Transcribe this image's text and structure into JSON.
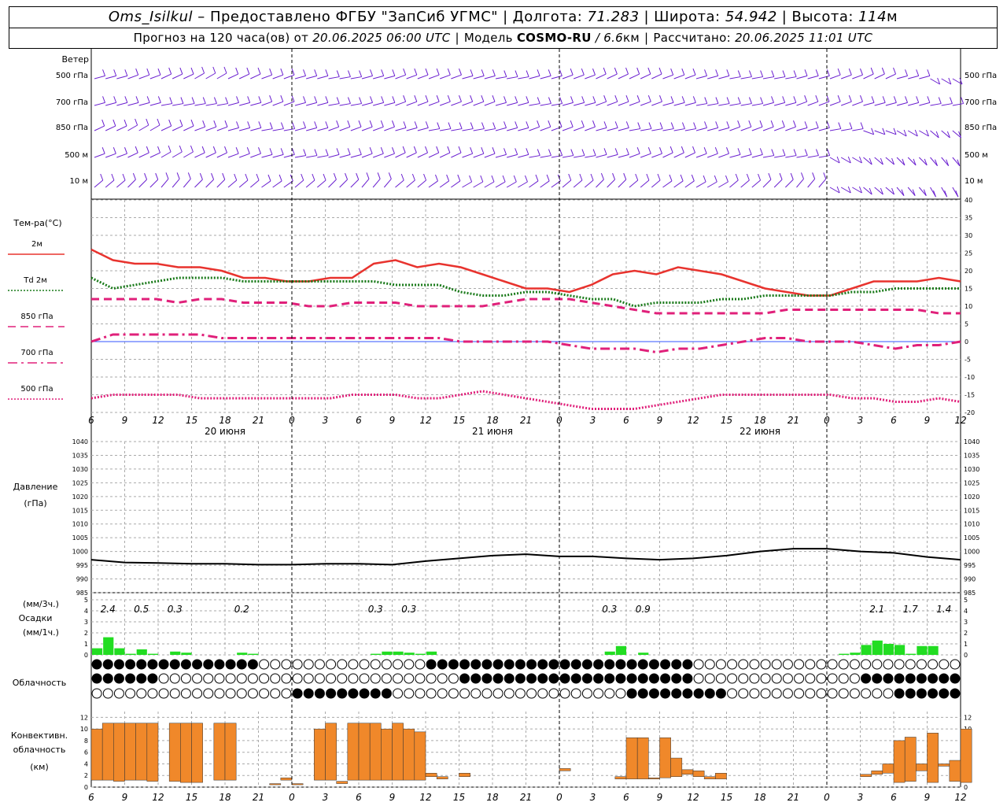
{
  "header": {
    "station": "Oms_Isilkul",
    "provided": "– Предоставлено ФГБУ \"ЗапСиб УГМС\"",
    "lon_label": "Долгота:",
    "lon": "71.283",
    "lat_label": "Широта:",
    "lat": "54.942",
    "alt_label": "Высота:",
    "alt": "114",
    "alt_unit": "м",
    "forecast_prefix": "Прогноз на 120 часа(ов) от",
    "forecast_time": "20.06.2025 06:00 UTC",
    "model_label": "Модель",
    "model_name": "COSMO-RU",
    "model_res": "/ 6.6",
    "model_res_unit": "км",
    "computed_label": "Рассчитано:",
    "computed_time": "20.06.2025 11:01 UTC"
  },
  "panels": {
    "wind": {
      "title": "Ветер",
      "levels": [
        "500 гПа",
        "700 гПа",
        "850 гПа",
        "500 м",
        "10 м"
      ]
    },
    "temperature": {
      "title": "Тем-ра(°C)",
      "legend": [
        {
          "label": "2м",
          "color": "#e8332e",
          "style": "solid"
        },
        {
          "label": "Td 2м",
          "color": "#1a7a1a",
          "style": "dotted"
        },
        {
          "label": "850 гПа",
          "color": "#e0207a",
          "style": "dashed"
        },
        {
          "label": "700 гПа",
          "color": "#e0207a",
          "style": "dashdot"
        },
        {
          "label": "500 гПа",
          "color": "#e0207a",
          "style": "dotted"
        }
      ]
    },
    "pressure": {
      "title": "Давление",
      "unit": "(гПа)"
    },
    "precip": {
      "unit3": "(мм/3ч.)",
      "title": "Осадки",
      "unit1": "(мм/1ч.)"
    },
    "cloud": {
      "title": "Облачность"
    },
    "convective": {
      "title1": "Конвективн.",
      "title2": "облачность",
      "unit": "(км)"
    }
  },
  "time_axis": {
    "hour_labels": [
      "6",
      "9",
      "12",
      "15",
      "18",
      "21",
      "0",
      "3",
      "6",
      "9",
      "12",
      "15",
      "18",
      "21",
      "0",
      "3",
      "6",
      "9",
      "12",
      "15",
      "18",
      "21",
      "0",
      "3",
      "6",
      "9",
      "12"
    ],
    "day_labels": [
      {
        "hour": 12,
        "label": "20 июня"
      },
      {
        "hour": 36,
        "label": "21 июня"
      },
      {
        "hour": 60,
        "label": "22 июня"
      }
    ]
  },
  "chart_data": [
    {
      "type": "line",
      "title": "Тем-ра(°C)",
      "ylim": [
        -20,
        40
      ],
      "yticks": [
        "40",
        "35",
        "30",
        "25",
        "20",
        "15",
        "10",
        "5",
        "0",
        "-5",
        "-10",
        "-15",
        "-20"
      ],
      "x_hours_from_start": [
        0,
        2,
        4,
        6,
        8,
        10,
        12,
        14,
        16,
        18,
        20,
        22,
        24,
        26,
        28,
        30,
        32,
        34,
        36,
        38,
        40,
        42,
        44,
        46,
        48,
        50,
        52,
        54,
        56,
        58,
        60,
        62,
        64,
        66,
        68,
        70,
        72,
        74,
        76,
        78
      ],
      "series": [
        {
          "name": "2м",
          "color": "#e8332e",
          "style": "solid",
          "values": [
            26,
            23,
            22,
            22,
            21,
            21,
            20,
            18,
            18,
            17,
            17,
            18,
            18,
            22,
            23,
            21,
            22,
            21,
            19,
            17,
            15,
            15,
            14,
            16,
            19,
            20,
            19,
            21,
            20,
            19,
            17,
            15,
            14,
            13,
            13,
            15,
            17,
            17,
            17,
            18,
            17
          ]
        },
        {
          "name": "Td 2м",
          "color": "#1a7a1a",
          "style": "dotted",
          "values": [
            18,
            15,
            16,
            17,
            18,
            18,
            18,
            17,
            17,
            17,
            17,
            17,
            17,
            17,
            16,
            16,
            16,
            14,
            13,
            13,
            14,
            14,
            13,
            12,
            12,
            10,
            11,
            11,
            11,
            12,
            12,
            13,
            13,
            13,
            13,
            14,
            14,
            15,
            15,
            15,
            15
          ]
        },
        {
          "name": "850 гПа",
          "color": "#e0207a",
          "style": "dashed",
          "values": [
            12,
            12,
            12,
            12,
            11,
            12,
            12,
            11,
            11,
            11,
            10,
            10,
            11,
            11,
            11,
            10,
            10,
            10,
            10,
            11,
            12,
            12,
            12,
            11,
            10,
            9,
            8,
            8,
            8,
            8,
            8,
            8,
            9,
            9,
            9,
            9,
            9,
            9,
            9,
            8,
            8
          ]
        },
        {
          "name": "700 гПа",
          "color": "#e0207a",
          "style": "dashdot",
          "values": [
            0,
            2,
            2,
            2,
            2,
            2,
            1,
            1,
            1,
            1,
            1,
            1,
            1,
            1,
            1,
            1,
            1,
            0,
            0,
            0,
            0,
            0,
            -1,
            -2,
            -2,
            -2,
            -3,
            -2,
            -2,
            -1,
            0,
            1,
            1,
            0,
            0,
            0,
            -1,
            -2,
            -1,
            -1,
            0
          ]
        },
        {
          "name": "500 гПа",
          "color": "#e0207a",
          "style": "dotted",
          "values": [
            -16,
            -15,
            -15,
            -15,
            -15,
            -16,
            -16,
            -16,
            -16,
            -16,
            -16,
            -16,
            -15,
            -15,
            -15,
            -16,
            -16,
            -15,
            -14,
            -15,
            -16,
            -17,
            -18,
            -19,
            -19,
            -19,
            -18,
            -17,
            -16,
            -15,
            -15,
            -15,
            -15,
            -15,
            -15,
            -16,
            -16,
            -17,
            -17,
            -16,
            -17
          ]
        }
      ]
    },
    {
      "type": "line",
      "title": "Давление",
      "ylabel": "(гПа)",
      "ylim": [
        985,
        1040
      ],
      "yticks": [
        "1040",
        "1035",
        "1030",
        "1025",
        "1020",
        "1015",
        "1010",
        "1005",
        "1000",
        "995",
        "990",
        "985"
      ],
      "series": [
        {
          "name": "",
          "color": "#000000",
          "x_hours_from_start": [
            0,
            3,
            6,
            9,
            12,
            15,
            18,
            21,
            24,
            27,
            30,
            33,
            36,
            39,
            42,
            45,
            48,
            51,
            54,
            57,
            60,
            63,
            66,
            69,
            72,
            75,
            78
          ],
          "values": [
            997,
            996,
            995.8,
            995.5,
            995.5,
            995.2,
            995.2,
            995.5,
            995.5,
            995.2,
            996.5,
            997.5,
            998.5,
            999,
            998.2,
            998.2,
            997.5,
            997,
            997.5,
            998.5,
            1000,
            1001,
            1001,
            1000,
            999.5,
            998,
            997
          ]
        }
      ]
    },
    {
      "type": "bar",
      "title": "Осадки",
      "ylim": [
        0,
        5
      ],
      "yticks": [
        "5",
        "4",
        "3",
        "2",
        "1",
        "0"
      ],
      "labels_3h": [
        {
          "hour": 1.5,
          "value": "2.4"
        },
        {
          "hour": 4.5,
          "value": "0.5"
        },
        {
          "hour": 7.5,
          "value": "0.3"
        },
        {
          "hour": 13.5,
          "value": "0.2"
        },
        {
          "hour": 25.5,
          "value": "0.3"
        },
        {
          "hour": 28.5,
          "value": "0.3"
        },
        {
          "hour": 46.5,
          "value": "0.3"
        },
        {
          "hour": 49.5,
          "value": "0.9"
        },
        {
          "hour": 70.5,
          "value": "2.1"
        },
        {
          "hour": 73.5,
          "value": "1.7"
        },
        {
          "hour": 76.5,
          "value": "1.4"
        }
      ],
      "hourly_mm": [
        0.6,
        1.6,
        0.6,
        0.1,
        0.5,
        0.1,
        0.0,
        0.3,
        0.2,
        0,
        0,
        0,
        0,
        0.2,
        0.1,
        0,
        0,
        0,
        0,
        0,
        0,
        0,
        0,
        0,
        0,
        0.1,
        0.3,
        0.3,
        0.2,
        0.1,
        0.3,
        0,
        0,
        0,
        0,
        0,
        0,
        0,
        0,
        0,
        0,
        0,
        0,
        0,
        0,
        0,
        0.3,
        0.8,
        0,
        0.2,
        0,
        0,
        0,
        0,
        0,
        0,
        0,
        0,
        0,
        0,
        0,
        0,
        0,
        0,
        0,
        0,
        0,
        0.1,
        0.2,
        0.9,
        1.3,
        1.0,
        0.9,
        0.1,
        0.8,
        0.8
      ]
    },
    {
      "type": "bar",
      "title": "Конвективн. облачность",
      "ylabel": "(км)",
      "ylim": [
        0,
        13
      ],
      "yticks": [
        "12",
        "10",
        "8",
        "6",
        "4",
        "2",
        "0"
      ],
      "bars_km": [
        {
          "h": 0,
          "base": 1.2,
          "top": 10
        },
        {
          "h": 1,
          "base": 1.2,
          "top": 11
        },
        {
          "h": 2,
          "base": 1.0,
          "top": 11
        },
        {
          "h": 3,
          "base": 1.2,
          "top": 11
        },
        {
          "h": 4,
          "base": 1.2,
          "top": 11
        },
        {
          "h": 5,
          "base": 1.0,
          "top": 11
        },
        {
          "h": 7,
          "base": 1.0,
          "top": 11
        },
        {
          "h": 8,
          "base": 0.8,
          "top": 11
        },
        {
          "h": 9,
          "base": 0.8,
          "top": 11
        },
        {
          "h": 11,
          "base": 1.2,
          "top": 11
        },
        {
          "h": 12,
          "base": 1.2,
          "top": 11
        },
        {
          "h": 16,
          "base": 0.4,
          "top": 0.6
        },
        {
          "h": 17,
          "base": 1.2,
          "top": 1.6
        },
        {
          "h": 18,
          "base": 0.4,
          "top": 0.6
        },
        {
          "h": 20,
          "base": 1.2,
          "top": 10
        },
        {
          "h": 21,
          "base": 1.2,
          "top": 11
        },
        {
          "h": 22,
          "base": 0.6,
          "top": 1.0
        },
        {
          "h": 23,
          "base": 1.2,
          "top": 11
        },
        {
          "h": 24,
          "base": 1.2,
          "top": 11
        },
        {
          "h": 25,
          "base": 1.2,
          "top": 11
        },
        {
          "h": 26,
          "base": 1.2,
          "top": 10
        },
        {
          "h": 27,
          "base": 1.2,
          "top": 11
        },
        {
          "h": 28,
          "base": 1.2,
          "top": 10
        },
        {
          "h": 29,
          "base": 1.2,
          "top": 9.5
        },
        {
          "h": 30,
          "base": 1.8,
          "top": 2.4
        },
        {
          "h": 31,
          "base": 1.4,
          "top": 1.8
        },
        {
          "h": 33,
          "base": 1.8,
          "top": 2.4
        },
        {
          "h": 42,
          "base": 2.8,
          "top": 3.2
        },
        {
          "h": 47,
          "base": 1.4,
          "top": 1.8
        },
        {
          "h": 48,
          "base": 1.4,
          "top": 8.5
        },
        {
          "h": 49,
          "base": 1.4,
          "top": 8.5
        },
        {
          "h": 50,
          "base": 1.4,
          "top": 1.6
        },
        {
          "h": 51,
          "base": 1.6,
          "top": 8.5
        },
        {
          "h": 52,
          "base": 1.8,
          "top": 5
        },
        {
          "h": 53,
          "base": 2.2,
          "top": 3
        },
        {
          "h": 54,
          "base": 1.8,
          "top": 2.8
        },
        {
          "h": 55,
          "base": 1.4,
          "top": 1.8
        },
        {
          "h": 56,
          "base": 1.4,
          "top": 2.4
        },
        {
          "h": 69,
          "base": 1.8,
          "top": 2.2
        },
        {
          "h": 70,
          "base": 2.2,
          "top": 2.8
        },
        {
          "h": 71,
          "base": 2.4,
          "top": 4
        },
        {
          "h": 72,
          "base": 0.8,
          "top": 8
        },
        {
          "h": 73,
          "base": 1.0,
          "top": 8.6
        },
        {
          "h": 74,
          "base": 2.8,
          "top": 4
        },
        {
          "h": 75,
          "base": 0.8,
          "top": 9.3
        },
        {
          "h": 76,
          "base": 3.6,
          "top": 4
        },
        {
          "h": 77,
          "base": 1.0,
          "top": 4.6
        },
        {
          "h": 78,
          "base": 0.8,
          "top": 10
        }
      ]
    }
  ]
}
